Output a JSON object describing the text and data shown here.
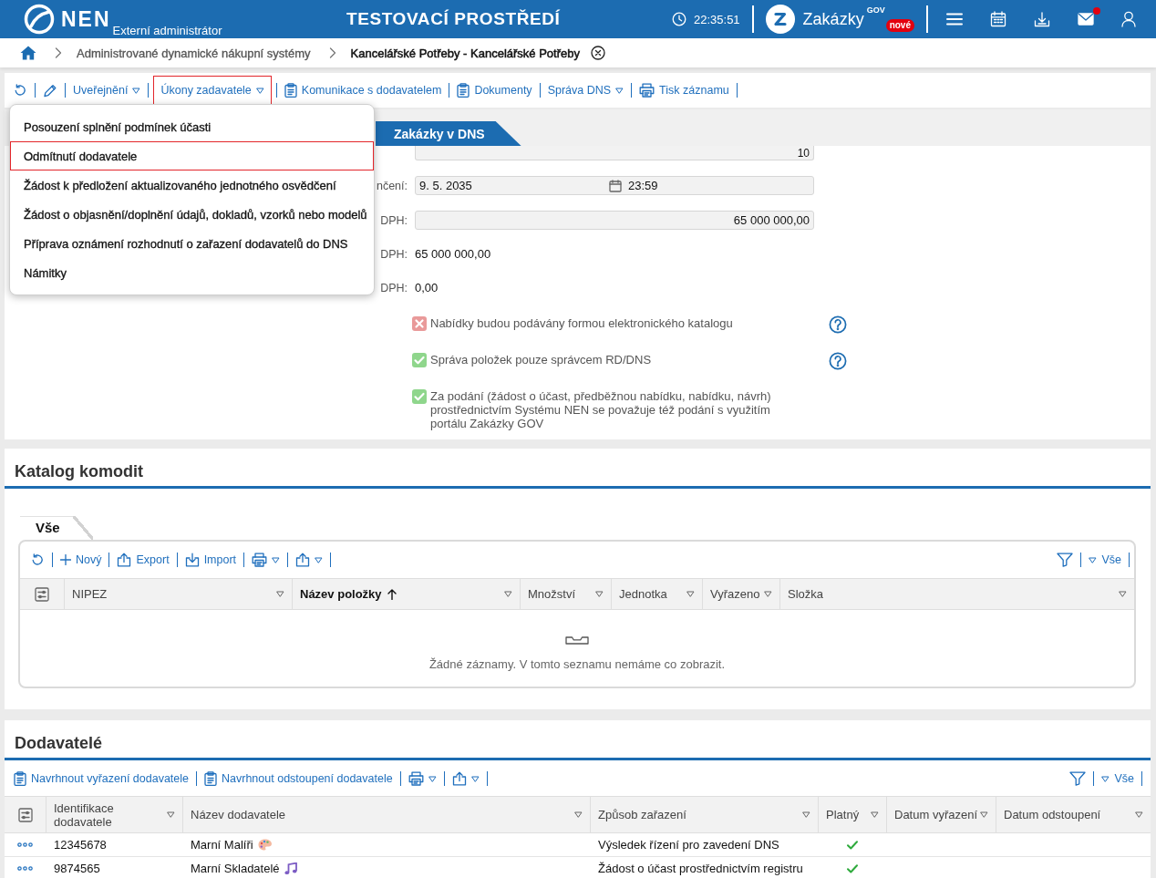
{
  "header": {
    "logo_text": "NEN",
    "subtitle": "Externí administrátor",
    "environment": "TESTOVACÍ PROSTŘEDÍ",
    "time": "22:35:51",
    "portal": {
      "name": "Zakázky",
      "superscript": "GOV",
      "badge": "nové"
    },
    "notifications_unread": true
  },
  "breadcrumb": [
    {
      "label": "Administrované dynamické nákupní systémy",
      "current": false
    },
    {
      "label": "Kancelářské Potřeby - Kancelářské Potřeby",
      "current": true
    }
  ],
  "toolbar": [
    {
      "kind": "refresh",
      "dropdown": false,
      "highlighted": false
    },
    {
      "kind": "edit",
      "dropdown": false,
      "highlighted": false
    },
    {
      "kind": "text",
      "label": "Uveřejnění",
      "dropdown": true,
      "highlighted": false
    },
    {
      "kind": "text",
      "label": "Úkony zadavatele",
      "dropdown": true,
      "highlighted": true
    },
    {
      "kind": "clipboard",
      "label": "Komunikace s dodavatelem",
      "dropdown": false,
      "highlighted": false
    },
    {
      "kind": "clipboard",
      "label": "Dokumenty",
      "dropdown": false,
      "highlighted": false
    },
    {
      "kind": "text",
      "label": "Správa DNS",
      "dropdown": true,
      "highlighted": false
    },
    {
      "kind": "print",
      "label": "Tisk záznamu",
      "dropdown": false,
      "highlighted": false
    }
  ],
  "dropdown_menu": {
    "items": [
      {
        "label": "Posouzení splnění podmínek účasti",
        "highlighted": false
      },
      {
        "label": "Odmítnutí dodavatele",
        "highlighted": true
      },
      {
        "label": "Žádost k předložení aktualizovaného jednotného osvědčení",
        "highlighted": false
      },
      {
        "label": "Žádost o objasnění/doplnění údajů, dokladů, vzorků nebo modelů",
        "highlighted": false
      },
      {
        "label": "Příprava oznámení rozhodnutí o zařazení dodavatelů do DNS",
        "highlighted": false
      },
      {
        "label": "Námitky",
        "highlighted": false
      }
    ]
  },
  "form": {
    "tabs": [
      {
        "label": "Zakázky v DNS",
        "selected": true
      }
    ],
    "fields": [
      {
        "kind": "input",
        "value": "10"
      },
      {
        "kind": "datetime",
        "label": "nčení:",
        "date": "9. 5. 2035",
        "time": "23:59"
      },
      {
        "kind": "input",
        "label": "DPH:",
        "value": "65 000 000,00"
      },
      {
        "kind": "text",
        "label": "DPH:",
        "value": "65 000 000,00"
      },
      {
        "kind": "text",
        "label": "DPH:",
        "value": "0,00"
      }
    ],
    "flags": [
      {
        "label": "Nabídky budou podávány formou elektronického katalogu",
        "checked": false,
        "help": true
      },
      {
        "label": "Správa položek pouze správcem RD/DNS",
        "checked": true,
        "help": true
      },
      {
        "label": "Za podání (žádost o účast, předběžnou nabídku, nabídku, návrh) prostřednictvím Systému NEN se považuje též podání s využitím portálu Zakázky GOV",
        "checked": true,
        "help": false
      }
    ]
  },
  "catalog": {
    "title": "Katalog komodit",
    "tabs": [
      {
        "label": "Vše",
        "selected": true
      }
    ],
    "toolbar": [
      {
        "kind": "refresh",
        "dropdown": false
      },
      {
        "kind": "add",
        "label": "Nový",
        "dropdown": false
      },
      {
        "kind": "export",
        "label": "Export",
        "dropdown": false
      },
      {
        "kind": "import",
        "label": "Import",
        "dropdown": false
      },
      {
        "kind": "print",
        "dropdown": true
      },
      {
        "kind": "export",
        "dropdown": true
      }
    ],
    "filter": {
      "label": "Vše"
    },
    "columns": [
      {
        "label": "NIPEZ",
        "sorted": false
      },
      {
        "label": "Název položky",
        "sorted": true
      },
      {
        "label": "Množství",
        "sorted": false
      },
      {
        "label": "Jednotka",
        "sorted": false
      },
      {
        "label": "Vyřazeno",
        "sorted": false
      },
      {
        "label": "Složka",
        "sorted": false
      }
    ],
    "empty_message": "Žádné záznamy. V tomto seznamu nemáme co zobrazit."
  },
  "suppliers": {
    "title": "Dodavatelé",
    "toolbar": [
      {
        "kind": "propose",
        "label": "Navrhnout vyřazení dodavatele",
        "dropdown": false
      },
      {
        "kind": "propose",
        "label": "Navrhnout odstoupení dodavatele",
        "dropdown": false
      },
      {
        "kind": "print",
        "dropdown": true
      },
      {
        "kind": "export",
        "dropdown": true
      }
    ],
    "filter": {
      "label": "Vše"
    },
    "columns": [
      {
        "label": "Identifikace dodavatele",
        "sorted": false
      },
      {
        "label": "Název dodavatele",
        "sorted": false
      },
      {
        "label": "Způsob zařazení",
        "sorted": false
      },
      {
        "label": "Platný",
        "sorted": false
      },
      {
        "label": "Datum vyřazení",
        "sorted": false
      },
      {
        "label": "Datum odstoupení",
        "sorted": false
      }
    ],
    "rows": [
      {
        "id": "12345678",
        "name": "Marní Malíři",
        "method": "Výsledek řízení pro zavedení DNS",
        "valid": true
      },
      {
        "id": "9874565",
        "name": "Marní Skladatelé",
        "method": "Žádost o účast prostřednictvím registru",
        "valid": true
      }
    ]
  }
}
